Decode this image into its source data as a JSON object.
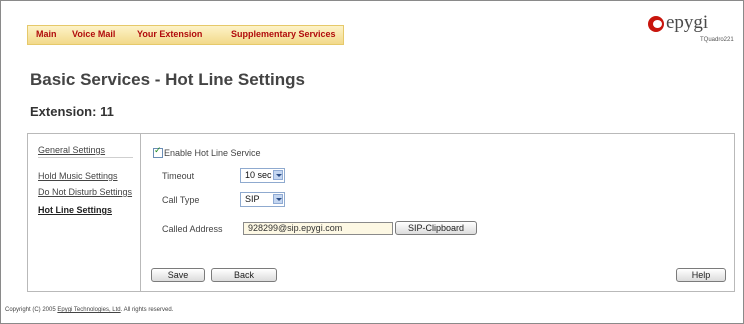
{
  "nav": {
    "items": [
      "Main",
      "Voice Mail",
      "Your Extension",
      "Supplementary Services"
    ]
  },
  "logo": {
    "text": "epygi",
    "sub": "TQuadro221"
  },
  "page": {
    "title": "Basic Services - Hot Line Settings",
    "extension": "Extension: 11"
  },
  "sidebar": {
    "items": [
      {
        "label": "General Settings"
      },
      {
        "label": "Hold Music Settings"
      },
      {
        "label": "Do Not Disturb Settings"
      },
      {
        "label": "Hot Line Settings",
        "active": true
      }
    ]
  },
  "form": {
    "enable_label": "Enable Hot Line Service",
    "enable_checked": true,
    "timeout_label": "Timeout",
    "timeout_value": "10 sec",
    "calltype_label": "Call Type",
    "calltype_value": "SIP",
    "address_label": "Called Address",
    "address_value": "928299@sip.epygi.com",
    "clipboard_label": "SIP-Clipboard"
  },
  "buttons": {
    "save": "Save",
    "back": "Back",
    "help": "Help"
  },
  "footer": {
    "prefix": "Copyright (C) 2005 ",
    "link": "Epygi Technologies, Ltd",
    "suffix": ". All rights reserved."
  }
}
